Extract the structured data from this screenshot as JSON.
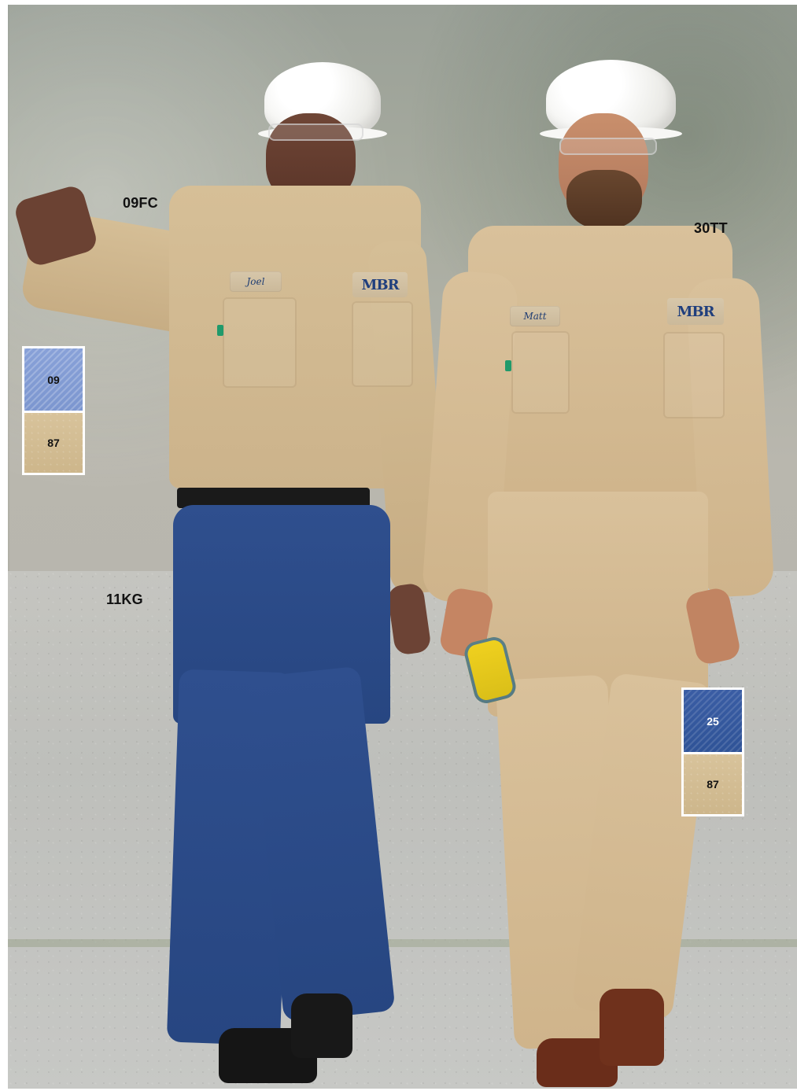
{
  "labels": {
    "left_shirt": "09FC",
    "left_pants": "11KG",
    "right_outfit": "30TT"
  },
  "left_swatches": [
    {
      "code": "09"
    },
    {
      "code": "87"
    }
  ],
  "right_swatches": [
    {
      "code": "25"
    },
    {
      "code": "87"
    }
  ],
  "name_tags": {
    "left": "Joel",
    "right": "Matt"
  }
}
